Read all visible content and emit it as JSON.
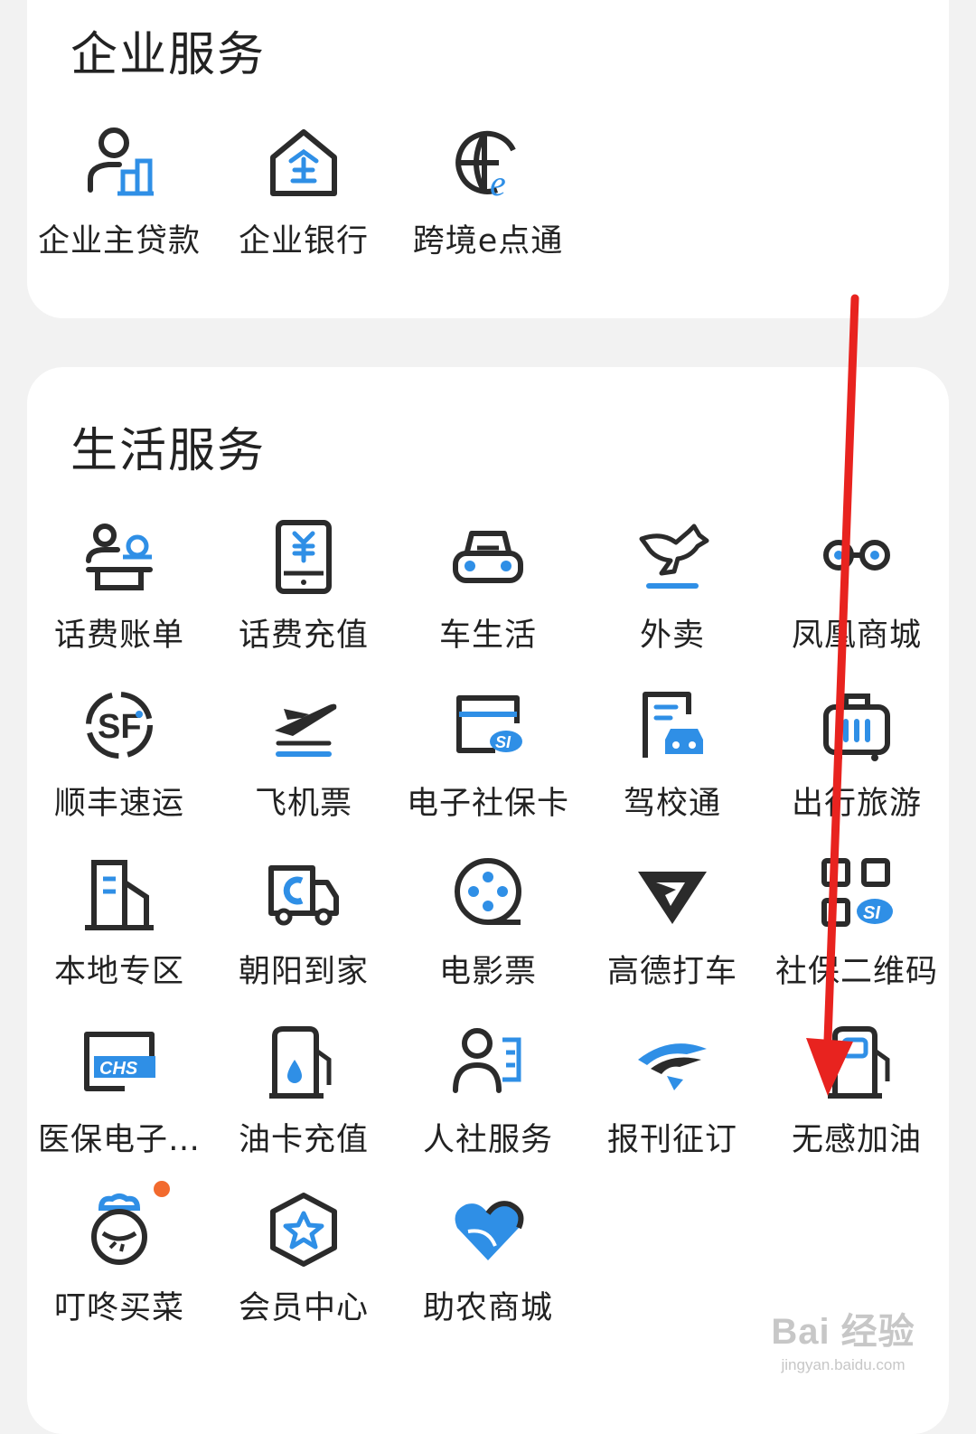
{
  "enterprise": {
    "title": "企业服务",
    "items": [
      {
        "label": "企业主贷款",
        "icon": "user-building-icon"
      },
      {
        "label": "企业银行",
        "icon": "enterprise-house-icon"
      },
      {
        "label": "跨境e点通",
        "icon": "globe-e-icon"
      }
    ]
  },
  "life": {
    "title": "生活服务",
    "items": [
      {
        "label": "话费账单",
        "icon": "phone-bill-icon"
      },
      {
        "label": "话费充值",
        "icon": "phone-recharge-icon"
      },
      {
        "label": "车生活",
        "icon": "car-icon"
      },
      {
        "label": "外卖",
        "icon": "kangaroo-icon"
      },
      {
        "label": "凤凰商城",
        "icon": "mall-icon"
      },
      {
        "label": "顺丰速运",
        "icon": "sf-express-icon"
      },
      {
        "label": "飞机票",
        "icon": "airplane-icon"
      },
      {
        "label": "电子社保卡",
        "icon": "social-security-card-icon"
      },
      {
        "label": "驾校通",
        "icon": "driving-school-icon"
      },
      {
        "label": "出行旅游",
        "icon": "luggage-icon"
      },
      {
        "label": "本地专区",
        "icon": "local-building-icon"
      },
      {
        "label": "朝阳到家",
        "icon": "delivery-truck-icon"
      },
      {
        "label": "电影票",
        "icon": "film-reel-icon"
      },
      {
        "label": "高德打车",
        "icon": "amap-icon"
      },
      {
        "label": "社保二维码",
        "icon": "qr-code-icon"
      },
      {
        "label": "医保电子…",
        "icon": "chs-card-icon"
      },
      {
        "label": "油卡充值",
        "icon": "fuel-card-icon"
      },
      {
        "label": "人社服务",
        "icon": "person-service-icon"
      },
      {
        "label": "报刊征订",
        "icon": "newspaper-icon"
      },
      {
        "label": "无感加油",
        "icon": "fuel-pump-icon"
      },
      {
        "label": "叮咚买菜",
        "icon": "dingdong-icon"
      },
      {
        "label": "会员中心",
        "icon": "member-star-icon"
      },
      {
        "label": "助农商城",
        "icon": "heart-leaf-icon"
      }
    ]
  },
  "watermark": {
    "logo": "Bai 经验",
    "url": "jingyan.baidu.com"
  },
  "colors": {
    "accent": "#2f8fe6",
    "dark": "#2b2b2b",
    "arrow": "#e8231f",
    "badge": "#f26a2e"
  }
}
